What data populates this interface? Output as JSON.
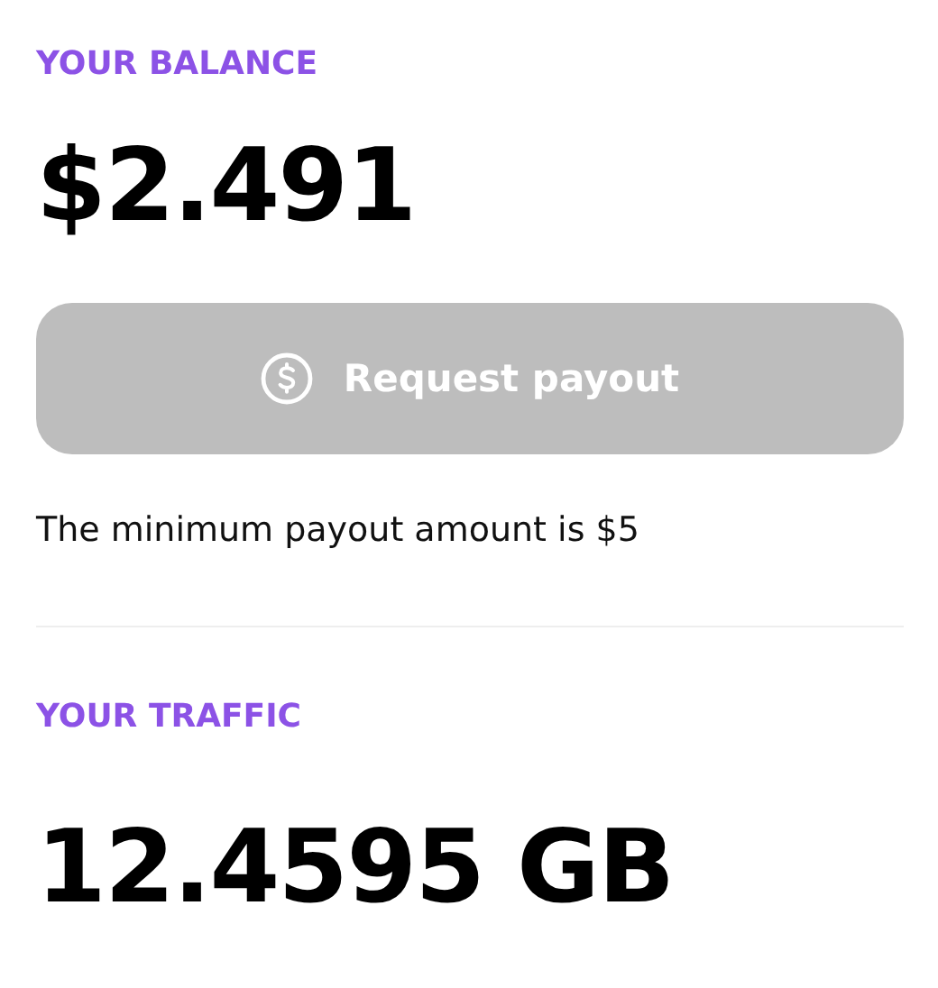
{
  "balance": {
    "label": "YOUR BALANCE",
    "amount": "$2.491"
  },
  "payout_button": {
    "label": "Request payout",
    "disabled": true
  },
  "note": "The minimum payout amount is $5",
  "traffic": {
    "label": "YOUR TRAFFIC",
    "amount": "12.4595 GB"
  }
}
